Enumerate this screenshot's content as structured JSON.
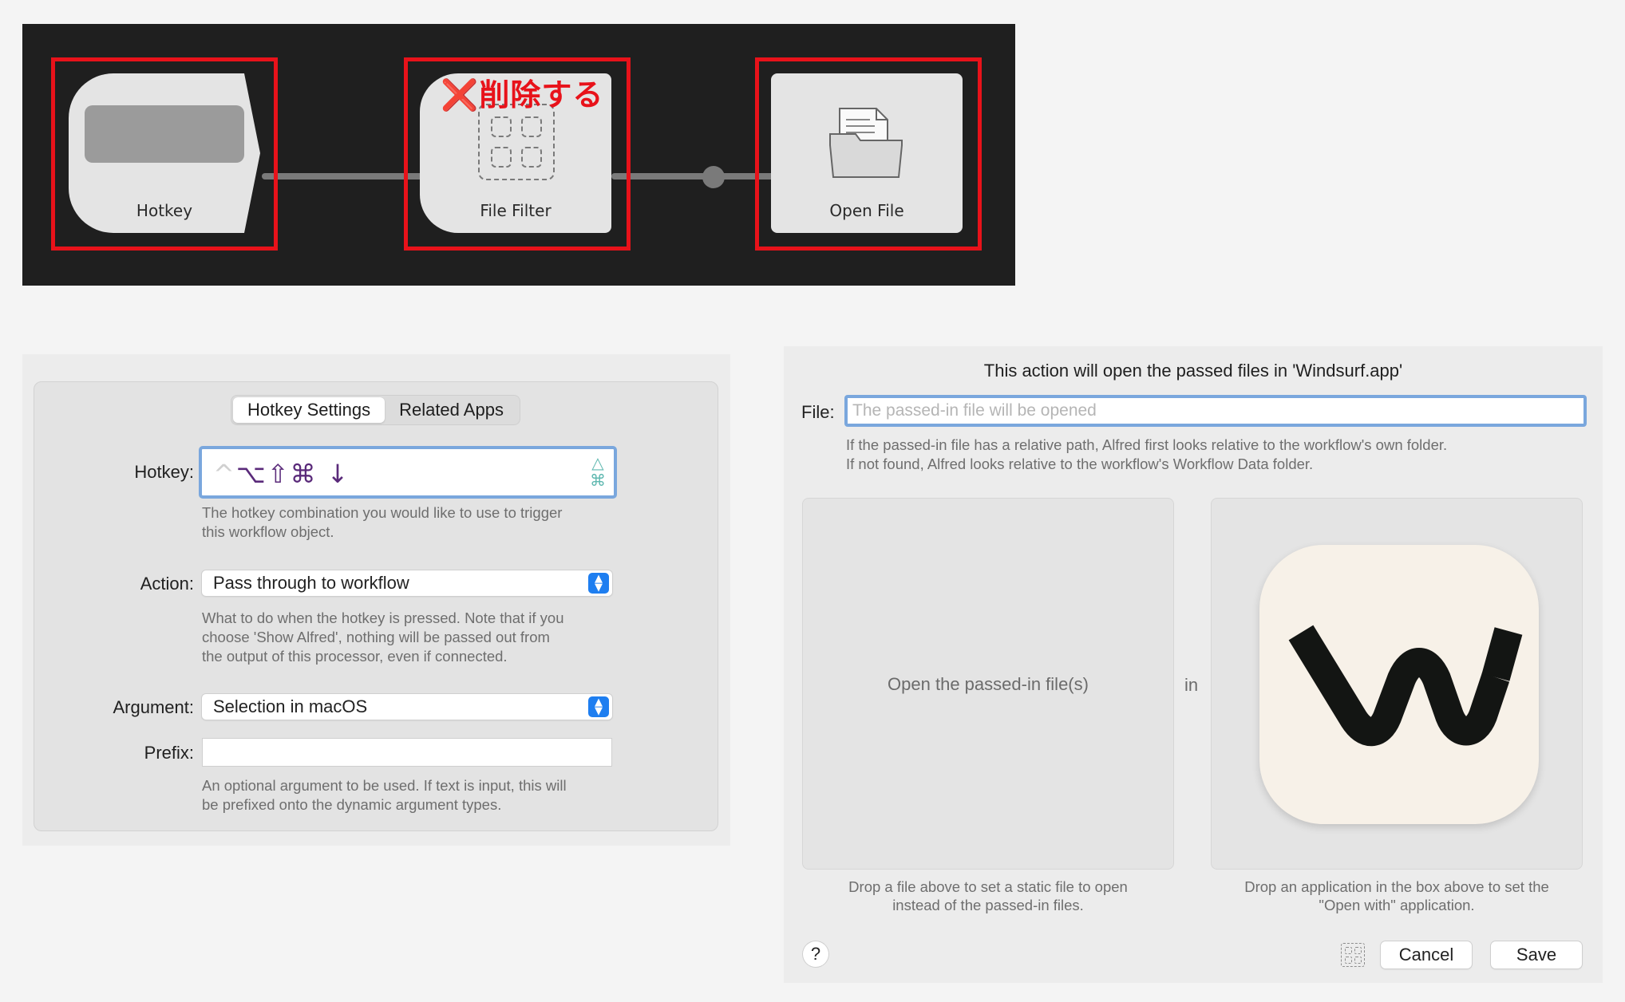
{
  "workflow": {
    "nodes": [
      {
        "label": "Hotkey"
      },
      {
        "label": "File Filter"
      },
      {
        "label": "Open File"
      }
    ],
    "delete_note": "❌削除する",
    "highlight_color": "#e8121a"
  },
  "hotkey_panel": {
    "tabs": [
      {
        "label": "Hotkey Settings",
        "active": true
      },
      {
        "label": "Related Apps",
        "active": false
      }
    ],
    "hotkey": {
      "label": "Hotkey:",
      "dim_key": "^",
      "keys": "⌥⇧⌘ ↓",
      "side_symbols": [
        "△",
        "⌘"
      ],
      "help": [
        "The hotkey combination you would like to use to trigger",
        "this workflow object."
      ]
    },
    "action": {
      "label": "Action:",
      "value": "Pass through to workflow",
      "help": [
        "What to do when the hotkey is pressed. Note that if you",
        "choose 'Show Alfred', nothing will be passed out from",
        "the output of this processor, even if connected."
      ]
    },
    "argument": {
      "label": "Argument:",
      "value": "Selection in macOS"
    },
    "prefix": {
      "label": "Prefix:",
      "value": "",
      "help": [
        "An optional argument to be used. If text is input, this will",
        "be prefixed onto the dynamic argument types."
      ]
    }
  },
  "open_file_panel": {
    "title": "This action will open the passed files in 'Windsurf.app'",
    "file_label": "File:",
    "file_placeholder": "The passed-in file will be opened",
    "file_help": [
      "If the passed-in file has a relative path, Alfred first looks relative to the workflow's own folder.",
      "If not found, Alfred looks relative to the workflow's Workflow Data folder."
    ],
    "file_drop_text": "Open the passed-in file(s)",
    "in_text": "in",
    "file_caption": [
      "Drop a file above to set a static file to open",
      "instead of the passed-in files."
    ],
    "app_caption": [
      "Drop an application in the box above to set the",
      "\"Open with\" application."
    ],
    "help_button": "?",
    "cancel_label": "Cancel",
    "save_label": "Save",
    "accent_color": "#1e7ef0"
  }
}
